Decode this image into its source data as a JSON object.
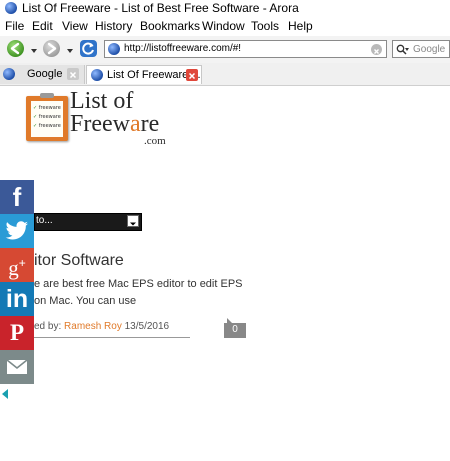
{
  "window": {
    "title": "List Of Freeware - List of Best Free Software - Arora"
  },
  "menu": [
    "File",
    "Edit",
    "View",
    "History",
    "Bookmarks",
    "Window",
    "Tools",
    "Help"
  ],
  "toolbar": {
    "url": "http://listoffreeware.com/#!",
    "search_placeholder": "Google"
  },
  "tabs": [
    {
      "label": "Google",
      "active": false
    },
    {
      "label": "List Of Freeware ...",
      "active": true
    }
  ],
  "logo": {
    "line1": "List of",
    "line2_a": "Freew",
    "line2_b": "a",
    "line2_c": "re",
    "line3": ".com",
    "note_lines": [
      "freeware",
      "freeware",
      "freeware"
    ]
  },
  "page": {
    "select_text": "to...",
    "heading": "itor Software",
    "desc_line1": "e are best free Mac EPS editor to edit EPS",
    "desc_line2": "on Mac. You can use",
    "posted_prefix": "ed by:",
    "author": "Ramesh Roy",
    "date": "13/5/2016",
    "comment_count": "0"
  },
  "share": [
    {
      "name": "facebook",
      "color": "#3b5998"
    },
    {
      "name": "twitter",
      "color": "#2a9bd6"
    },
    {
      "name": "google-plus",
      "color": "#d64933"
    },
    {
      "name": "linkedin",
      "color": "#1479b5"
    },
    {
      "name": "pinterest",
      "color": "#c9232b"
    },
    {
      "name": "email",
      "color": "#7c8a8a"
    }
  ]
}
